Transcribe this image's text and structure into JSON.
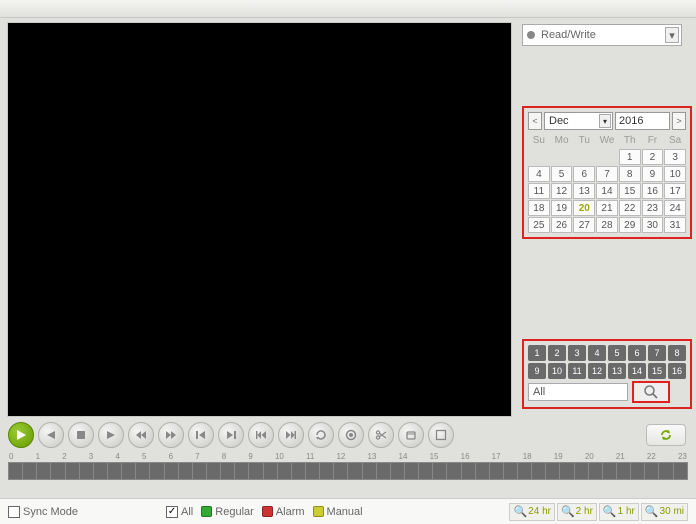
{
  "rw_mode": {
    "label": "Read/Write"
  },
  "calendar": {
    "month": "Dec",
    "year": "2016",
    "dow": [
      "Su",
      "Mo",
      "Tu",
      "We",
      "Th",
      "Fr",
      "Sa"
    ],
    "leading_blanks": 4,
    "days": 31,
    "today": 20
  },
  "channels": {
    "row1": [
      "1",
      "2",
      "3",
      "4",
      "5",
      "6",
      "7",
      "8"
    ],
    "row2": [
      "9",
      "10",
      "11",
      "12",
      "13",
      "14",
      "15",
      "16"
    ],
    "all_label": "All"
  },
  "timeline_hours": [
    "0",
    "1",
    "2",
    "3",
    "4",
    "5",
    "6",
    "7",
    "8",
    "9",
    "10",
    "11",
    "12",
    "13",
    "14",
    "15",
    "16",
    "17",
    "18",
    "19",
    "20",
    "21",
    "22",
    "23"
  ],
  "legend": {
    "sync_mode": "Sync Mode",
    "all": "All",
    "regular": {
      "label": "Regular",
      "color": "#3a3"
    },
    "alarm": {
      "label": "Alarm",
      "color": "#c33"
    },
    "manual": {
      "label": "Manual",
      "color": "#cc3"
    }
  },
  "zoom": {
    "z24": "24 hr",
    "z2": "2 hr",
    "z1": "1 hr",
    "z30": "30 mi"
  }
}
